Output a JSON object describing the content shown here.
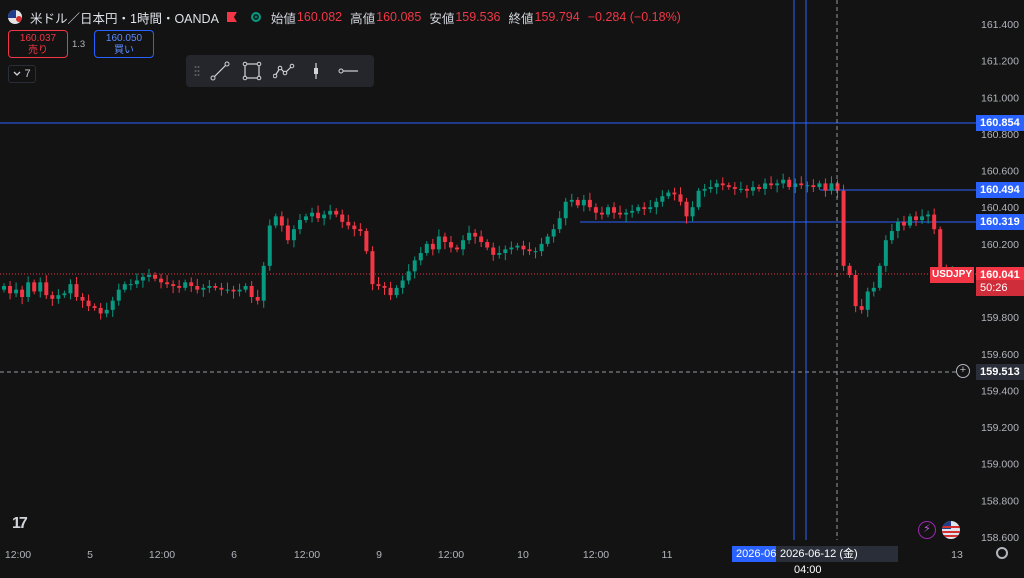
{
  "header": {
    "title": "米ドル／日本円・1時間・OANDA",
    "open_label": "始値",
    "open": "160.082",
    "high_label": "高値",
    "high": "160.085",
    "low_label": "安値",
    "low": "159.536",
    "close_label": "終値",
    "close": "159.794",
    "change": "−0.284 (−0.18%)"
  },
  "trade": {
    "bid": "160.037",
    "bid_label": "売り",
    "spread": "1.3",
    "ask": "160.050",
    "ask_label": "買い"
  },
  "indicators_count": "7",
  "drawing_toolbar": {
    "tools": [
      "trend-line-icon",
      "rectangle-icon",
      "path-icon",
      "long-position-icon",
      "horizontal-ray-icon"
    ]
  },
  "price_axis": {
    "ticks": [
      "161.400",
      "161.200",
      "161.000",
      "160.800",
      "160.600",
      "160.400",
      "160.200",
      "160.000",
      "159.800",
      "159.600",
      "159.400",
      "159.200",
      "159.000",
      "158.800",
      "158.600"
    ]
  },
  "price_labels": {
    "line1": "160.854",
    "line2": "160.494",
    "line3": "160.319",
    "current": "160.041",
    "countdown": "50:26",
    "crosshair": "159.513"
  },
  "symbol_tag": "USDJPY",
  "time_axis": {
    "labels": [
      "12:00",
      "5",
      "12:00",
      "6",
      "12:00",
      "9",
      "12:00",
      "10",
      "12:00",
      "11",
      "13"
    ]
  },
  "crosshair_time": {
    "left": "2026-06",
    "date": "2026-06-12 (金)",
    "time": "04:00"
  },
  "colors": {
    "up": "#089981",
    "down": "#f23645",
    "accent": "#2962ff",
    "background": "#131313"
  },
  "chart_data": {
    "type": "candlestick",
    "ylim": [
      158.6,
      161.4
    ],
    "closes": [
      159.97,
      159.93,
      159.95,
      159.91,
      159.99,
      159.94,
      159.99,
      159.92,
      159.9,
      159.92,
      159.93,
      159.98,
      159.91,
      159.89,
      159.86,
      159.85,
      159.82,
      159.84,
      159.89,
      159.95,
      159.98,
      159.98,
      160.0,
      160.02,
      160.03,
      160.01,
      159.99,
      159.98,
      159.97,
      159.96,
      159.99,
      159.97,
      159.95,
      159.96,
      159.97,
      159.96,
      159.95,
      159.95,
      159.94,
      159.95,
      159.97,
      159.91,
      159.89,
      160.08,
      160.3,
      160.35,
      160.3,
      160.22,
      160.28,
      160.33,
      160.35,
      160.37,
      160.34,
      160.36,
      160.38,
      160.36,
      160.32,
      160.3,
      160.28,
      160.27,
      160.16,
      159.98,
      159.97,
      159.96,
      159.92,
      159.96,
      160.0,
      160.05,
      160.11,
      160.15,
      160.2,
      160.17,
      160.24,
      160.21,
      160.18,
      160.17,
      160.22,
      160.26,
      160.24,
      160.21,
      160.18,
      160.14,
      160.15,
      160.17,
      160.18,
      160.19,
      160.17,
      160.16,
      160.16,
      160.2,
      160.24,
      160.28,
      160.34,
      160.43,
      160.44,
      160.41,
      160.44,
      160.4,
      160.37,
      160.36,
      160.4,
      160.37,
      160.36,
      160.37,
      160.38,
      160.4,
      160.39,
      160.4,
      160.43,
      160.46,
      160.48,
      160.47,
      160.43,
      160.35,
      160.4,
      160.49,
      160.5,
      160.51,
      160.53,
      160.52,
      160.51,
      160.5,
      160.5,
      160.49,
      160.51,
      160.5,
      160.53,
      160.52,
      160.53,
      160.55,
      160.51,
      160.53,
      160.52,
      160.52,
      160.51,
      160.53,
      160.49,
      160.53,
      160.49,
      160.08,
      160.03,
      159.86,
      159.84,
      159.94,
      159.96,
      160.08,
      160.22,
      160.27,
      160.32,
      160.3,
      160.35,
      160.33,
      160.35,
      160.36,
      160.28,
      160.06,
      160.04,
      160.04
    ]
  }
}
